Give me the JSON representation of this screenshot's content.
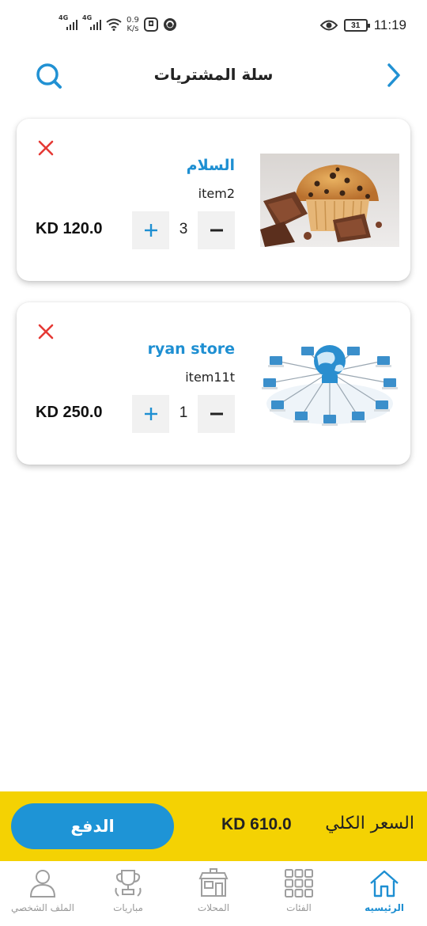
{
  "status_bar": {
    "network_1": "4G",
    "network_2": "4G",
    "speed_value": "0.9",
    "speed_unit": "K/s",
    "battery": "31",
    "time": "11:19"
  },
  "header": {
    "title": "سلة المشتريات",
    "back_icon": "chevron-right-icon",
    "search_icon": "search-icon"
  },
  "cart": {
    "items": [
      {
        "store": "السلام",
        "item": "item2",
        "quantity": "3",
        "price": "KD 120.0",
        "image": "muffin-chocolate-photo"
      },
      {
        "store": "ryan store",
        "item": "item11t",
        "quantity": "1",
        "price": "KD 250.0",
        "image": "network-globe-illustration"
      }
    ]
  },
  "checkout": {
    "pay_label": "الدفع",
    "total_amount": "KD 610.0",
    "total_label": "السعر الكلي"
  },
  "bottom_nav": {
    "items": [
      {
        "label": "الرئيسيه",
        "icon": "home-icon",
        "active": true
      },
      {
        "label": "الفئات",
        "icon": "grid-icon",
        "active": false
      },
      {
        "label": "المحلات",
        "icon": "store-icon",
        "active": false
      },
      {
        "label": "مباريات",
        "icon": "trophy-icon",
        "active": false
      },
      {
        "label": "الملف الشخصي",
        "icon": "user-icon",
        "active": false
      }
    ]
  },
  "colors": {
    "accent_blue": "#1e94d6",
    "checkout_yellow": "#f4d203",
    "remove_red": "#e53935"
  }
}
